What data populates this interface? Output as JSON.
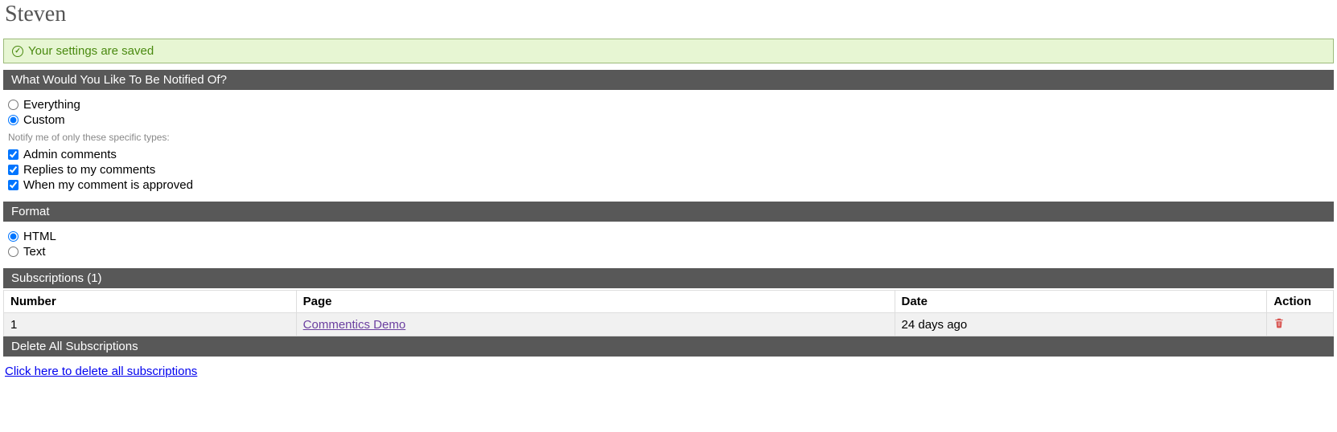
{
  "page_title": "Steven",
  "alert": {
    "message": "Your settings are saved"
  },
  "notify": {
    "header": "What Would You Like To Be Notified Of?",
    "options": {
      "everything": "Everything",
      "custom": "Custom"
    },
    "selected": "custom",
    "hint": "Notify me of only these specific types:",
    "types": {
      "admin": {
        "label": "Admin comments",
        "checked": true
      },
      "replies": {
        "label": "Replies to my comments",
        "checked": true
      },
      "approved": {
        "label": "When my comment is approved",
        "checked": true
      }
    }
  },
  "format": {
    "header": "Format",
    "options": {
      "html": "HTML",
      "text": "Text"
    },
    "selected": "html"
  },
  "subscriptions": {
    "header": "Subscriptions (1)",
    "columns": {
      "number": "Number",
      "page": "Page",
      "date": "Date",
      "action": "Action"
    },
    "rows": [
      {
        "number": "1",
        "page": "Commentics Demo",
        "date": "24 days ago"
      }
    ]
  },
  "delete_all": {
    "header": "Delete All Subscriptions",
    "link": "Click here to delete all subscriptions"
  }
}
